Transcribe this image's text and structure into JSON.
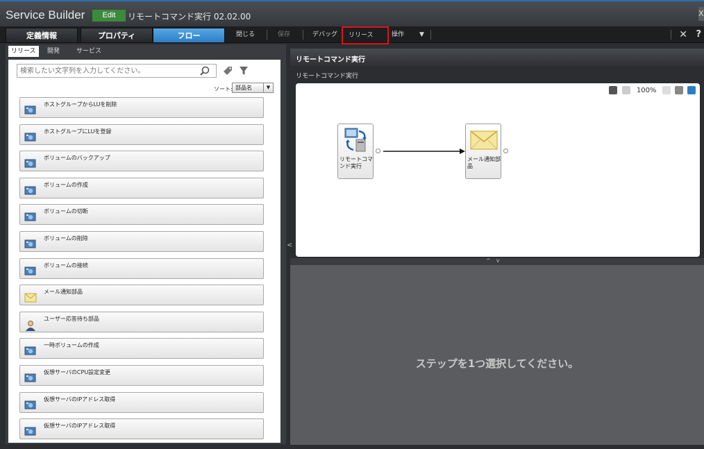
{
  "window": {
    "app_title": "Service Builder",
    "mode_badge": "Edit",
    "service_name": "リモートコマンド実行 02.02.00",
    "close_glyph": "X"
  },
  "tabs": [
    {
      "label": "定義情報",
      "active": false
    },
    {
      "label": "プロパティ",
      "active": false
    },
    {
      "label": "フロー",
      "active": true
    }
  ],
  "toolbar": {
    "close_label": "閉じる",
    "save_label": "保存",
    "debug_label": "デバッグ",
    "release_label": "リリース",
    "operation_label": "操作",
    "operation_arrow": "▼",
    "x_glyph": "✕",
    "help_glyph": "?",
    "highlight_color": "#e0121b"
  },
  "left_panel": {
    "subtabs": [
      "リリース",
      "開発",
      "サービス"
    ],
    "search_placeholder": "検索したい文字列を入力してください。",
    "sort_label": "ソート:",
    "sort_value": "部品名",
    "sort_arrow": "▼",
    "items": [
      {
        "label": "ホストグループからLUを削除",
        "icon": "component-icon"
      },
      {
        "label": "ホストグループにLUを登録",
        "icon": "component-icon"
      },
      {
        "label": "ボリュームのバックアップ",
        "icon": "component-icon"
      },
      {
        "label": "ボリュームの作成",
        "icon": "component-icon"
      },
      {
        "label": "ボリュームの切断",
        "icon": "component-icon"
      },
      {
        "label": "ボリュームの削除",
        "icon": "component-icon"
      },
      {
        "label": "ボリュームの接続",
        "icon": "component-icon"
      },
      {
        "label": "メール通知部品",
        "icon": "mail-icon"
      },
      {
        "label": "ユーザー応答待ち部品",
        "icon": "user-icon"
      },
      {
        "label": "一時ボリュームの作成",
        "icon": "component-icon"
      },
      {
        "label": "仮想サーバのCPU設定変更",
        "icon": "component-icon"
      },
      {
        "label": "仮想サーバのIPアドレス取得",
        "icon": "component-icon"
      },
      {
        "label": "仮想サーバのIPアドレス取得",
        "icon": "component-icon"
      }
    ]
  },
  "flow": {
    "title": "リモートコマンド実行",
    "subtitle": "リモートコマンド実行",
    "zoom": "100%",
    "nodes": [
      {
        "label": "リモートコマンド実行",
        "icon": "remote-command-icon"
      },
      {
        "label": "メール通知部品",
        "icon": "mail-icon"
      }
    ]
  },
  "detail": {
    "empty_message": "ステップを1つ選択してください。"
  },
  "colors": {
    "accent_blue": "#2c7ec4",
    "edit_green": "#3c8a3c",
    "panel_dark": "#2b2d30"
  }
}
